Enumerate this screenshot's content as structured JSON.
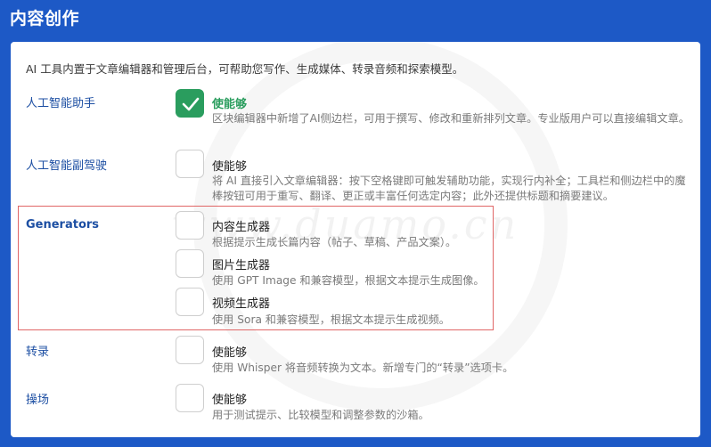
{
  "header": {
    "title": "内容创作"
  },
  "intro": "AI 工具内置于文章编辑器和管理后台，可帮助您写作、生成媒体、转录音频和探索模型。",
  "watermark": "www.duamo.cn",
  "sections": {
    "assistant": {
      "label": "人工智能助手",
      "option": "使能够",
      "checked": true,
      "desc": "区块编辑器中新增了AI侧边栏，可用于撰写、修改和重新排列文章。专业版用户可以直接编辑文章。"
    },
    "copilot": {
      "label": "人工智能副驾驶",
      "option": "使能够",
      "checked": false,
      "desc": "将 AI 直接引入文章编辑器：按下空格键即可触发辅助功能，实现行内补全；工具栏和侧边栏中的魔棒按钮可用于重写、翻译、更正或丰富任何选定内容；此外还提供标题和摘要建议。"
    },
    "generators": {
      "label": "Generators",
      "items": [
        {
          "option": "内容生成器",
          "checked": false,
          "desc": "根据提示生成长篇内容（帖子、草稿、产品文案）。"
        },
        {
          "option": "图片生成器",
          "checked": false,
          "desc": "使用 GPT Image 和兼容模型，根据文本提示生成图像。"
        },
        {
          "option": "视频生成器",
          "checked": false,
          "desc": "使用 Sora 和兼容模型，根据文本提示生成视频。"
        }
      ]
    },
    "transcription": {
      "label": "转录",
      "option": "使能够",
      "checked": false,
      "desc": "使用 Whisper 将音频转换为文本。新增专门的“转录”选项卡。"
    },
    "playground": {
      "label": "操场",
      "option": "使能够",
      "checked": false,
      "desc": "用于测试提示、比较模型和调整参数的沙箱。"
    }
  },
  "colors": {
    "header": "#1d59c6",
    "accent": "#2a9d5e",
    "label": "#1d4fa3",
    "highlight_box": "#e06666"
  },
  "icons": {
    "check": "check-icon"
  }
}
